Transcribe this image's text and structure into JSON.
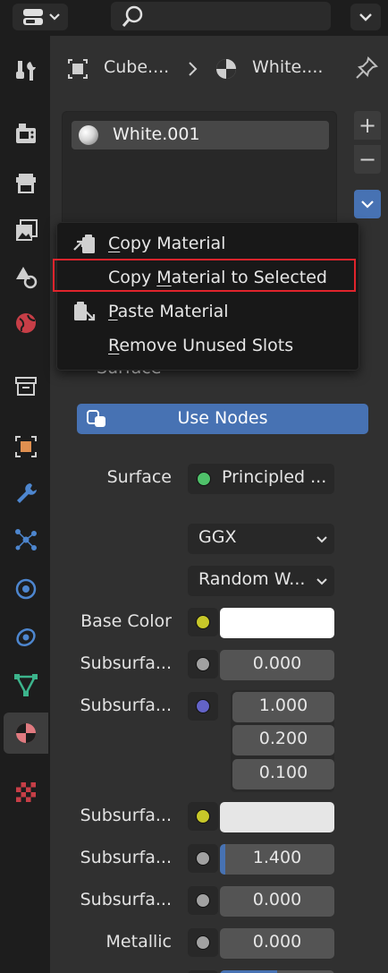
{
  "breadcrumb": {
    "object": "Cube....",
    "material": "White...."
  },
  "material_slots": [
    {
      "label": "White.001"
    }
  ],
  "slot_buttons": {
    "add": "+",
    "remove": "−"
  },
  "context_menu": {
    "items": [
      {
        "label": "Copy Material",
        "underline": "C",
        "rest": "opy Material"
      },
      {
        "label": "Copy Material to Selected",
        "pre": "Copy ",
        "underline": "M",
        "rest": "aterial to Selected"
      },
      {
        "label": "Paste Material",
        "underline": "P",
        "rest": "aste Material"
      },
      {
        "label": "Remove Unused Slots",
        "underline": "R",
        "rest": "emove Unused Slots"
      }
    ]
  },
  "panel": {
    "title": "Surface"
  },
  "use_nodes_label": "Use Nodes",
  "surface": {
    "label": "Surface",
    "value": "Principled ...",
    "socket_color": "#4fc16a"
  },
  "distribution": {
    "value": "GGX",
    "chevron": "⌄"
  },
  "subsurface_method": {
    "value": "Random W...",
    "chevron": "⌄"
  },
  "properties": [
    {
      "label": "Base Color",
      "value": "",
      "socket_color": "#c7c729",
      "swatch": "#ffffff"
    },
    {
      "label": "Subsurfa...",
      "value": "0.000",
      "socket_color": "#a1a1a1"
    },
    {
      "label": "Subsurfa...",
      "values": [
        "1.000",
        "0.200",
        "0.100"
      ],
      "socket_color": "#6363c7"
    },
    {
      "label": "Subsurfa...",
      "value": "",
      "socket_color": "#c7c729",
      "swatch": "#e6e6e6"
    },
    {
      "label": "Subsurfa...",
      "value": "1.400",
      "socket_color": "#a1a1a1",
      "fill": 0.05
    },
    {
      "label": "Subsurfa...",
      "value": "0.000",
      "socket_color": "#a1a1a1"
    },
    {
      "label": "Metallic",
      "value": "0.000",
      "socket_color": "#a1a1a1"
    }
  ],
  "colors": {
    "accent": "#4772b3",
    "highlight_box": "#e0242c"
  }
}
